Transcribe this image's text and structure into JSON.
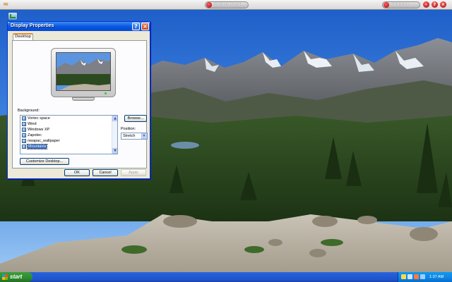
{
  "topbar": {
    "switch_label": "Switch Portal",
    "settings_label": "Settings"
  },
  "dialog": {
    "title": "Display Properties",
    "tab_label": "Desktop",
    "background_label": "Background:",
    "wallpapers": [
      "Vortec space",
      "Wind",
      "Windows XP",
      "Zapotec",
      "nwapac_wallpaper",
      "Mountains"
    ],
    "selected_wallpaper": "Mountains",
    "browse_label": "Browse...",
    "position_label": "Position:",
    "position_value": "Stretch",
    "customize_label": "Customize Desktop...",
    "ok_label": "OK",
    "cancel_label": "Cancel",
    "apply_label": "Apply"
  },
  "taskbar": {
    "start_label": "start",
    "clock": "1:37 AM"
  },
  "colors": {
    "xp_title_blue": "#0a58e0",
    "start_green": "#2f8a2f",
    "taskbar_blue": "#245edb",
    "selection_blue": "#316ac5"
  }
}
